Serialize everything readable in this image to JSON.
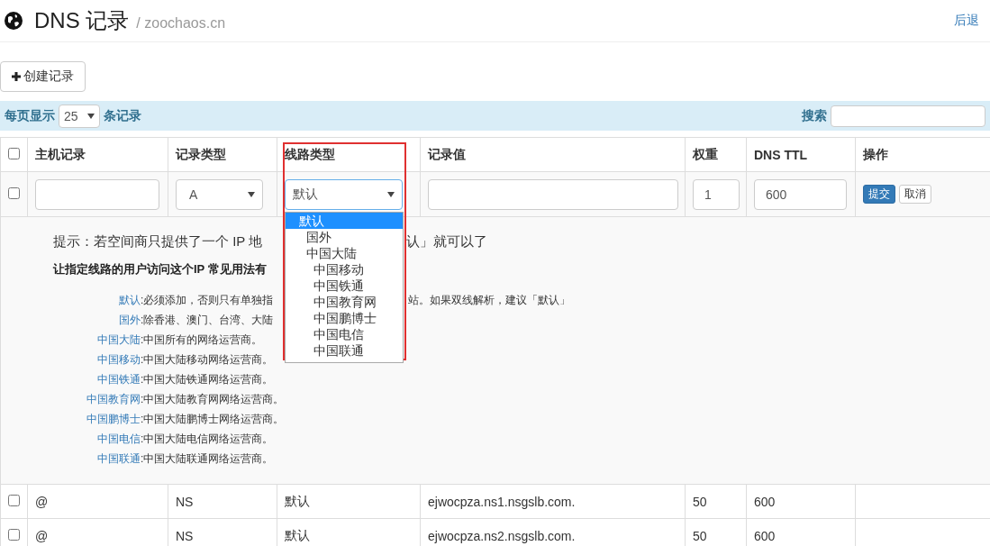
{
  "header": {
    "title": "DNS 记录",
    "subtitle": "/ zoochaos.cn",
    "back_link": "后退"
  },
  "create_button": "创建记录",
  "toolbar": {
    "page_size_label": "每页显示",
    "page_size": "25",
    "page_size_suffix": "条记录",
    "search_label": "搜索"
  },
  "table": {
    "select_all_checked": false,
    "columns": [
      "主机记录",
      "记录类型",
      "线路类型",
      "记录值",
      "权重",
      "DNS TTL",
      "操作"
    ],
    "new_row": {
      "checked": false,
      "record_type": "A",
      "line_type": "默认",
      "weight": "1",
      "ttl": "600",
      "buttons": [
        {
          "label": "提交",
          "kind": "primary"
        },
        {
          "label": "取消",
          "kind": "default"
        }
      ]
    },
    "line_dropdown": [
      {
        "label": "默认",
        "selected": true,
        "children": [
          {
            "label": "国外",
            "selected": false
          },
          {
            "label": "中国大陆",
            "selected": false,
            "children": [
              {
                "label": "中国移动",
                "selected": false
              },
              {
                "label": "中国铁通",
                "selected": false
              },
              {
                "label": "中国教育网",
                "selected": false
              },
              {
                "label": "中国鹏博士",
                "selected": false
              },
              {
                "label": "中国电信",
                "selected": false
              },
              {
                "label": "中国联通",
                "selected": false
              }
            ]
          }
        ]
      }
    ],
    "help": {
      "tip_parts": [
        "提示：若空间商只提供了一个 IP 地",
        "认」就可以了"
      ],
      "heading": "让指定线路的用户访问这个IP 常见用法有",
      "definitions": [
        {
          "term": "默认",
          "description_parts": [
            ":必须添加，否则只有单独指",
            "站。如果双线解析，建议「默认」"
          ]
        },
        {
          "term": "国外",
          "description_parts": [
            ":除香港、澳门、台湾、大陆"
          ]
        },
        {
          "term": "中国大陆",
          "description_parts": [
            ":中国所有的网络运营商。"
          ]
        },
        {
          "term": "中国移动",
          "description_parts": [
            ":中国大陆移动网络运营商。"
          ]
        },
        {
          "term": "中国铁通",
          "description_parts": [
            ":中国大陆铁通网络运营商。"
          ]
        },
        {
          "term": "中国教育网",
          "description_parts": [
            ":中国大陆教育网网络运营商。"
          ]
        },
        {
          "term": "中国鹏博士",
          "description_parts": [
            ":中国大陆鹏博士网络运营商。"
          ]
        },
        {
          "term": "中国电信",
          "description_parts": [
            ":中国大陆电信网络运营商。"
          ]
        },
        {
          "term": "中国联通",
          "description_parts": [
            ":中国大陆联通网络运营商。"
          ]
        }
      ]
    },
    "rows": [
      {
        "checked": false,
        "cells": [
          "@",
          "NS",
          "默认",
          "ejwocpza.ns1.nsgslb.com.",
          "50",
          "600"
        ]
      },
      {
        "checked": false,
        "cells": [
          "@",
          "NS",
          "默认",
          "ejwocpza.ns2.nsgslb.com.",
          "50",
          "600"
        ]
      }
    ]
  }
}
